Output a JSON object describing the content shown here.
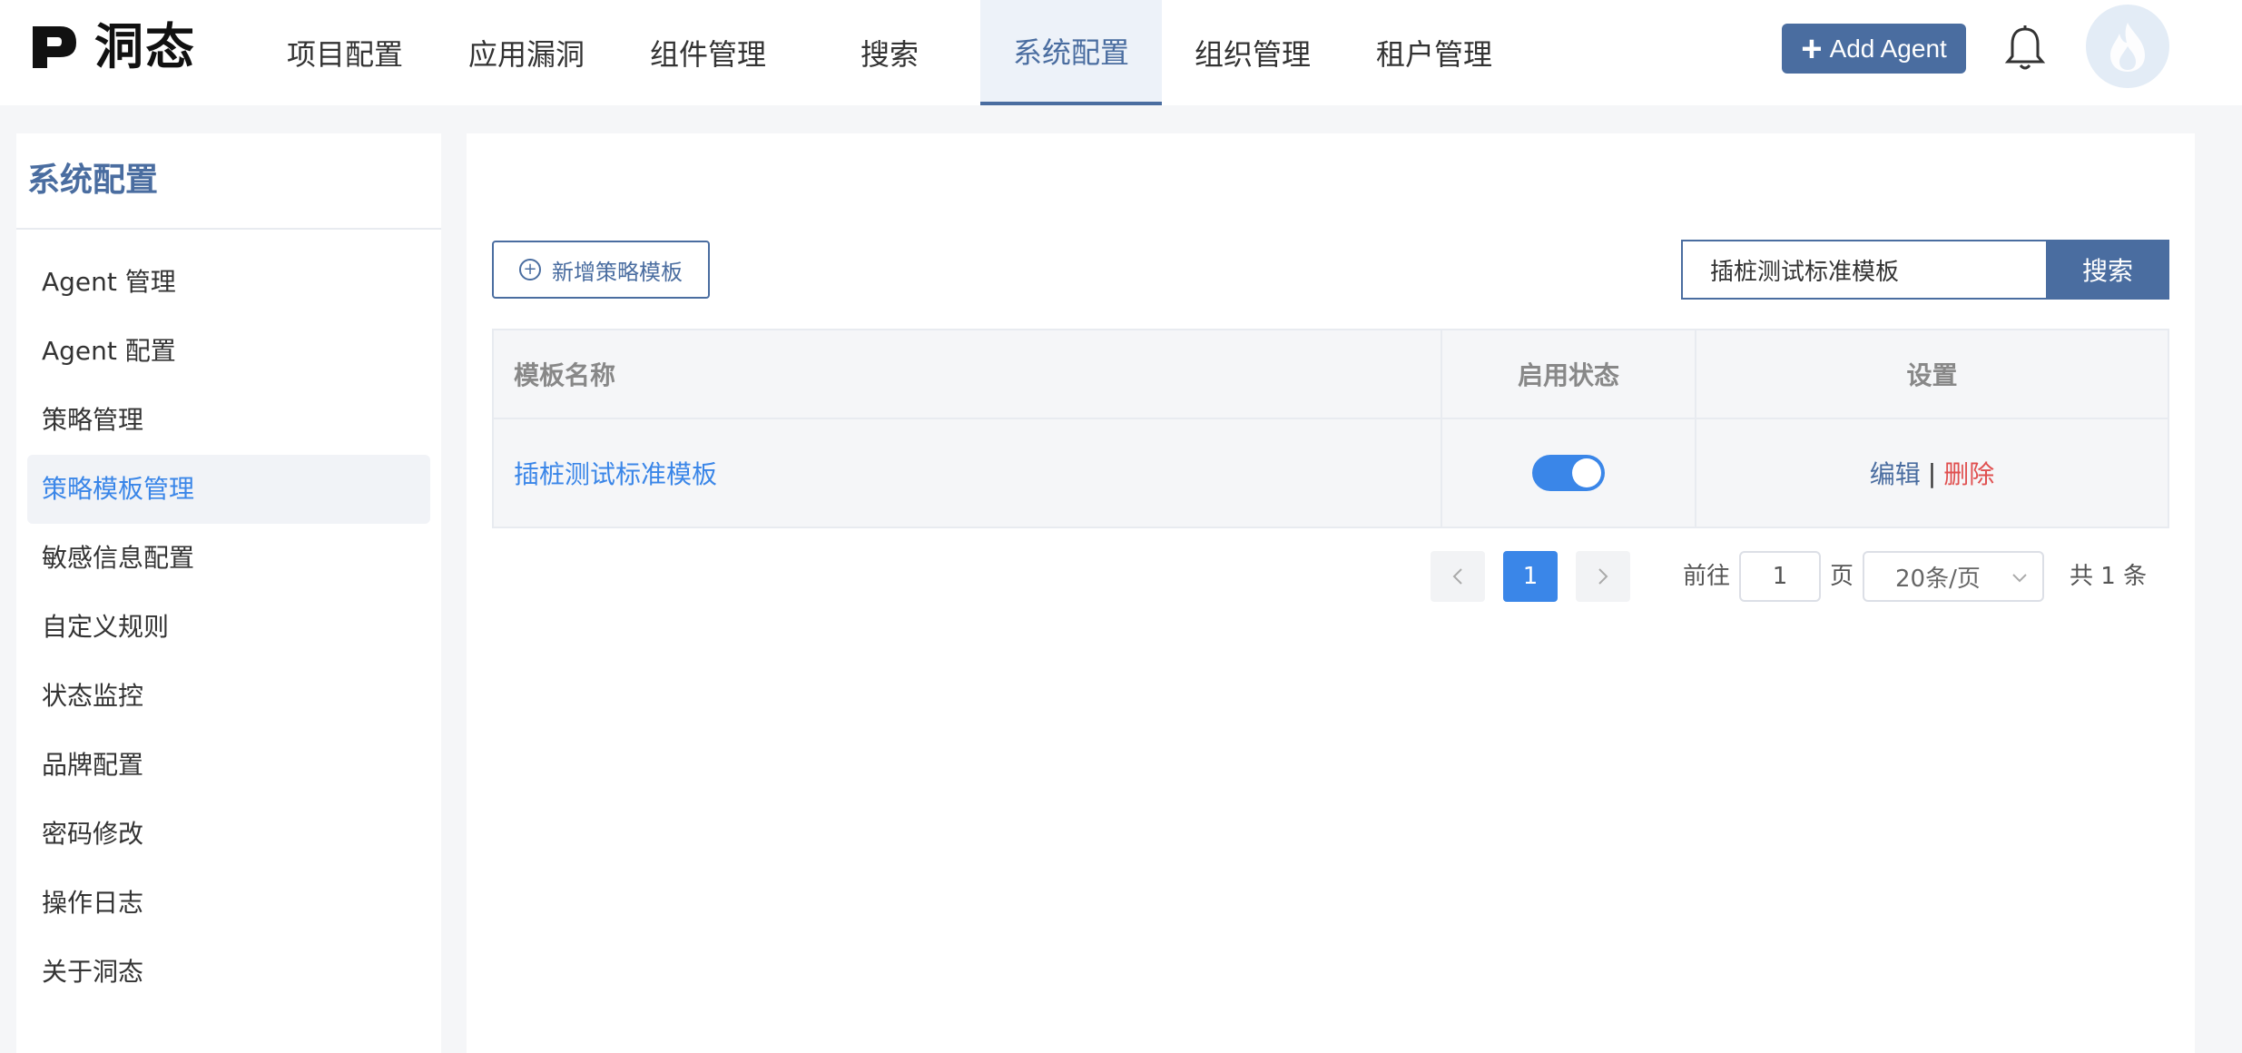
{
  "header": {
    "logo_text": "洞态",
    "nav": [
      {
        "label": "项目配置"
      },
      {
        "label": "应用漏洞"
      },
      {
        "label": "组件管理"
      },
      {
        "label": "搜索"
      },
      {
        "label": "系统配置",
        "active": true
      },
      {
        "label": "组织管理"
      },
      {
        "label": "租户管理"
      }
    ],
    "add_agent_label": "Add Agent",
    "icons": {
      "bell": "bell-icon",
      "avatar": "flame-avatar-icon",
      "logo": "dongtai-logo-icon"
    },
    "accent_color": "#4a6da0"
  },
  "sidebar": {
    "title": "系统配置",
    "items": [
      {
        "label": "Agent 管理"
      },
      {
        "label": "Agent 配置"
      },
      {
        "label": "策略管理"
      },
      {
        "label": "策略模板管理",
        "active": true
      },
      {
        "label": "敏感信息配置"
      },
      {
        "label": "自定义规则"
      },
      {
        "label": "状态监控"
      },
      {
        "label": "品牌配置"
      },
      {
        "label": "密码修改"
      },
      {
        "label": "操作日志"
      },
      {
        "label": "关于洞态"
      }
    ]
  },
  "main": {
    "new_template_button": "新增策略模板",
    "search": {
      "value": "插桩测试标准模板",
      "button_label": "搜索"
    },
    "table": {
      "headers": [
        "模板名称",
        "启用状态",
        "设置"
      ],
      "rows": [
        {
          "name": "插桩测试标准模板",
          "enabled": true,
          "edit_label": "编辑",
          "separator": "|",
          "delete_label": "删除"
        }
      ]
    },
    "pagination": {
      "current_page": "1",
      "goto_prefix": "前往",
      "goto_value": "1",
      "goto_suffix": "页",
      "page_size": "20条/页",
      "total": "共 1 条"
    }
  }
}
